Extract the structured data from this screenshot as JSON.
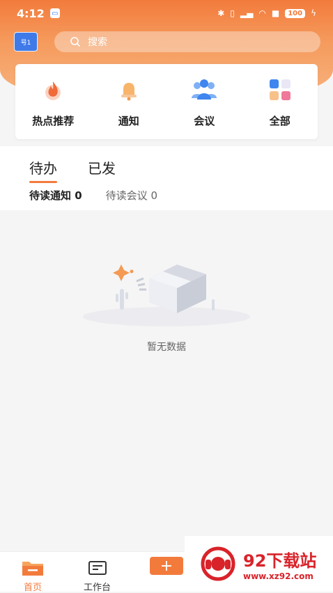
{
  "status_bar": {
    "time": "4:12",
    "battery": "100"
  },
  "header": {
    "org_badge": "号1",
    "search_placeholder": "搜索"
  },
  "shortcuts": [
    {
      "label": "热点推荐",
      "icon": "flame-icon"
    },
    {
      "label": "通知",
      "icon": "bell-icon"
    },
    {
      "label": "会议",
      "icon": "people-icon"
    },
    {
      "label": "全部",
      "icon": "grid-icon"
    }
  ],
  "todo": {
    "tabs": [
      {
        "label": "待办"
      },
      {
        "label": "已发"
      }
    ],
    "counts": [
      {
        "label": "待读通知 0"
      },
      {
        "label": "待读会议 0"
      }
    ]
  },
  "empty_state": {
    "text": "暂无数据"
  },
  "tabbar": {
    "items": [
      {
        "label": "首页"
      },
      {
        "label": "工作台"
      }
    ],
    "add_label": "+"
  },
  "watermark": {
    "title": "92下载站",
    "url": "www.xz92.com"
  },
  "colors": {
    "accent": "#f27b3c",
    "badge": "#3f7ae8"
  }
}
